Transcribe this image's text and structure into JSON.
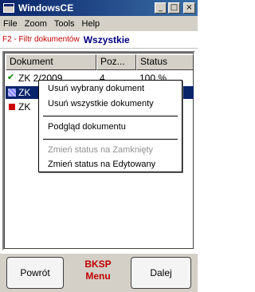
{
  "window": {
    "title": "WindowsCE"
  },
  "menu": [
    "File",
    "Zoom",
    "Tools",
    "Help"
  ],
  "filter": {
    "label": "F2 - Filtr dokumentów",
    "value": "Wszystkie"
  },
  "table": {
    "columns": [
      "Dokument",
      "Poz...",
      "Status"
    ],
    "rows": [
      {
        "doc": "ZK 2/2009",
        "poz": "4",
        "status": "100 %"
      },
      {
        "doc": "ZK",
        "poz": "",
        "status": ""
      },
      {
        "doc": "ZK",
        "poz": "",
        "status": ""
      }
    ]
  },
  "context_menu": {
    "items": [
      {
        "label": "Usuń wybrany dokument",
        "enabled": true
      },
      {
        "label": "Usuń wszystkie dokumenty",
        "enabled": true
      },
      {
        "label": "Podgląd dokumentu",
        "enabled": true
      },
      {
        "label": "Zmień status na Zamknięty",
        "enabled": false
      },
      {
        "label": "Zmień status na Edytowany",
        "enabled": true
      }
    ]
  },
  "bottom": {
    "left_button": "Powrót",
    "center_line1": "BKSP",
    "center_line2": "Menu",
    "right_button": "Dalej"
  },
  "colors": {
    "title_gradient_start": "#0a246a",
    "title_gradient_end": "#3a6ea5",
    "accent_red": "#c00000",
    "selection": "#0a246a"
  },
  "icons": {
    "row1": "check-icon",
    "row2": "selected-row-icon",
    "row3": "red-square-icon"
  }
}
